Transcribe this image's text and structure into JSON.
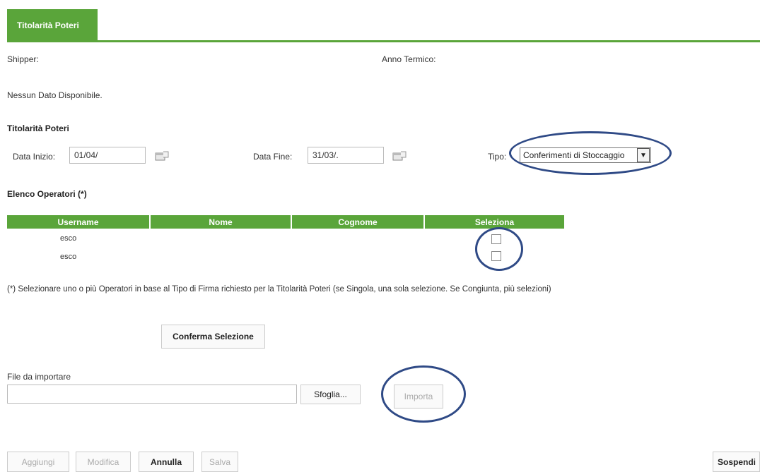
{
  "header": {
    "tab_label": "Titolarità Poteri"
  },
  "info": {
    "shipper_label": "Shipper:",
    "anno_termico_label": "Anno Termico:"
  },
  "messages": {
    "no_data": "Nessun Dato Disponibile."
  },
  "section": {
    "title": "Titolarità Poteri"
  },
  "filters": {
    "data_inizio_label": "Data Inizio:",
    "data_inizio_value": "01/04/",
    "data_fine_label": "Data Fine:",
    "data_fine_value": "31/03/.",
    "tipo_label": "Tipo:",
    "tipo_value": "Conferimenti di Stoccaggio"
  },
  "operators": {
    "title": "Elenco Operatori (*)",
    "columns": [
      "Username",
      "Nome",
      "Cognome",
      "Seleziona"
    ],
    "rows": [
      {
        "username": "esco",
        "nome": "",
        "cognome": "",
        "selected": false
      },
      {
        "username": "esco",
        "nome": "",
        "cognome": "",
        "selected": false
      }
    ],
    "footnote": "(*) Selezionare uno o più Operatori in base al Tipo di Firma richiesto per la Titolarità Poteri (se Singola, una sola selezione. Se Congiunta, più selezioni)",
    "confirm_label": "Conferma Selezione"
  },
  "import": {
    "label": "File da importare",
    "file_value": "",
    "browse_label": "Sfoglia...",
    "import_label": "Importa"
  },
  "actions": {
    "aggiungi": "Aggiungi",
    "modifica": "Modifica",
    "annulla": "Annulla",
    "salva": "Salva",
    "sospendi": "Sospendi"
  },
  "colors": {
    "accent_green": "#5aa53a",
    "highlight_oval": "#2f4a86"
  },
  "icons": {
    "calendar": "calendar-icon",
    "dropdown": "chevron-down-icon"
  }
}
